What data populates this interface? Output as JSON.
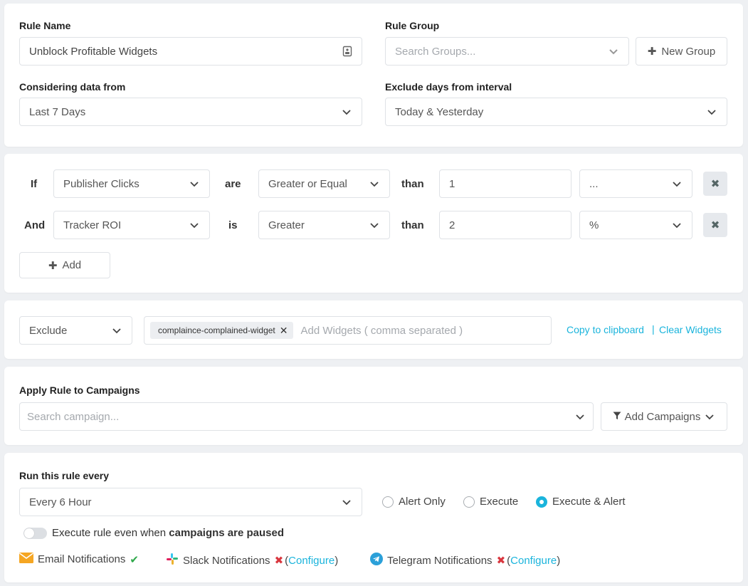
{
  "rule_name": {
    "label": "Rule Name",
    "value": "Unblock Profitable Widgets"
  },
  "rule_group": {
    "label": "Rule Group",
    "placeholder": "Search Groups...",
    "new_group": "New Group"
  },
  "considering": {
    "label": "Considering data from",
    "value": "Last 7 Days"
  },
  "exclude_days": {
    "label": "Exclude days from interval",
    "value": "Today & Yesterday"
  },
  "conditions": [
    {
      "connector": "If",
      "metric": "Publisher Clicks",
      "verb": "are",
      "operator": "Greater or Equal",
      "than": "than",
      "value": "1",
      "unit": "..."
    },
    {
      "connector": "And",
      "metric": "Tracker ROI",
      "verb": "is",
      "operator": "Greater",
      "than": "than",
      "value": "2",
      "unit": "%"
    }
  ],
  "add_condition": "Add",
  "widgets": {
    "mode": "Exclude",
    "chips": [
      "complaince-complained-widget"
    ],
    "placeholder": "Add Widgets ( comma separated )",
    "copy": "Copy to clipboard",
    "separator": "|",
    "clear": "Clear Widgets"
  },
  "campaigns": {
    "label": "Apply Rule to Campaigns",
    "placeholder": "Search campaign...",
    "add": "Add Campaigns"
  },
  "schedule": {
    "label": "Run this rule every",
    "value": "Every 6 Hour",
    "options": [
      {
        "label": "Alert Only",
        "selected": false
      },
      {
        "label": "Execute",
        "selected": false
      },
      {
        "label": "Execute & Alert",
        "selected": true
      }
    ],
    "paused_prefix": "Execute rule even when ",
    "paused_bold": "campaigns are paused"
  },
  "notifications": {
    "email": "Email Notifications",
    "slack": "Slack Notifications",
    "telegram": "Telegram Notifications",
    "configure": "Configure",
    "paren_open": "(",
    "paren_close": ")"
  },
  "colors": {
    "accent": "#1ab4dc",
    "success": "#2ea84a",
    "danger": "#d9363e",
    "email": "#f5a623"
  }
}
